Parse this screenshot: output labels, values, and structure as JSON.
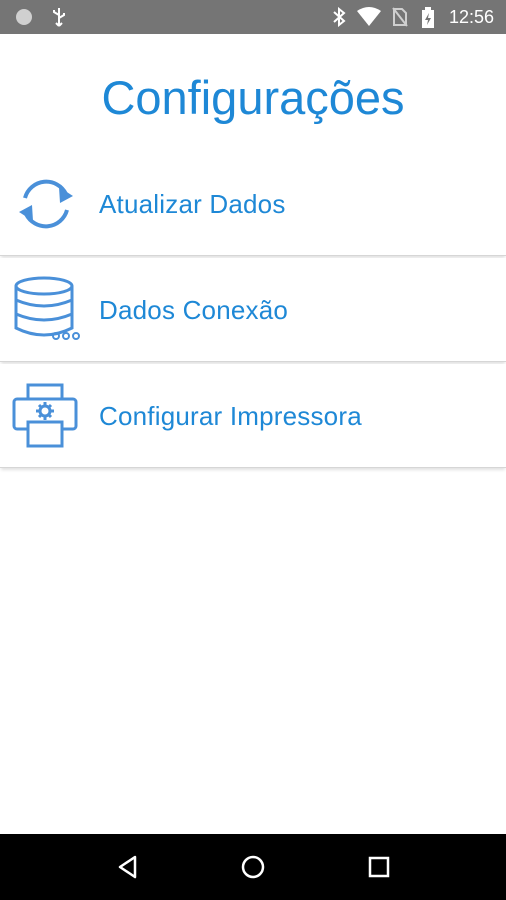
{
  "status_bar": {
    "time": "12:56",
    "icons": [
      "notification-dot-icon",
      "usb-icon",
      "bluetooth-icon",
      "wifi-icon",
      "no-sim-icon",
      "battery-charging-icon"
    ]
  },
  "header": {
    "title": "Configurações"
  },
  "menu": {
    "items": [
      {
        "label": "Atualizar Dados",
        "icon": "refresh-icon"
      },
      {
        "label": "Dados Conexão",
        "icon": "database-icon"
      },
      {
        "label": "Configurar Impressora",
        "icon": "printer-settings-icon"
      }
    ]
  },
  "nav_bar": {
    "buttons": [
      "back-icon",
      "home-icon",
      "recents-icon"
    ]
  },
  "colors": {
    "accent": "#1e88d6",
    "status_bar": "#757575",
    "nav_bar": "#000000"
  }
}
